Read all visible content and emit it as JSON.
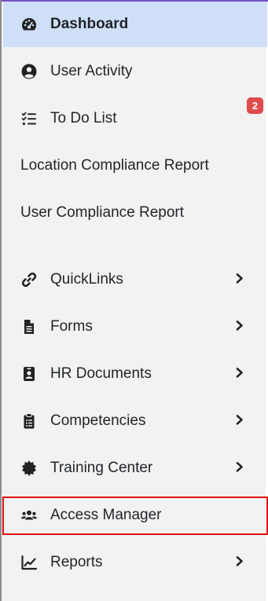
{
  "menu": {
    "dashboard": {
      "label": "Dashboard",
      "icon": "speedometer-icon"
    },
    "user_activity": {
      "label": "User Activity",
      "icon": "user-circle-icon"
    },
    "todo": {
      "label": "To Do List",
      "icon": "checklist-icon",
      "badge": "2"
    },
    "location_compliance": {
      "label": "Location Compliance Report"
    },
    "user_compliance": {
      "label": "User Compliance Report"
    },
    "quicklinks": {
      "label": "QuickLinks",
      "icon": "link-icon"
    },
    "forms": {
      "label": "Forms",
      "icon": "file-icon"
    },
    "hr_documents": {
      "label": "HR Documents",
      "icon": "id-badge-icon"
    },
    "competencies": {
      "label": "Competencies",
      "icon": "clipboard-list-icon"
    },
    "training_center": {
      "label": "Training Center",
      "icon": "certificate-icon"
    },
    "access_manager": {
      "label": "Access Manager",
      "icon": "users-icon"
    },
    "reports": {
      "label": "Reports",
      "icon": "chart-line-icon"
    }
  },
  "colors": {
    "active_bg": "#cfdff8",
    "badge_bg": "#e04b4b",
    "highlight_border": "#e01010",
    "sidebar_bg": "#f2f2f2"
  }
}
